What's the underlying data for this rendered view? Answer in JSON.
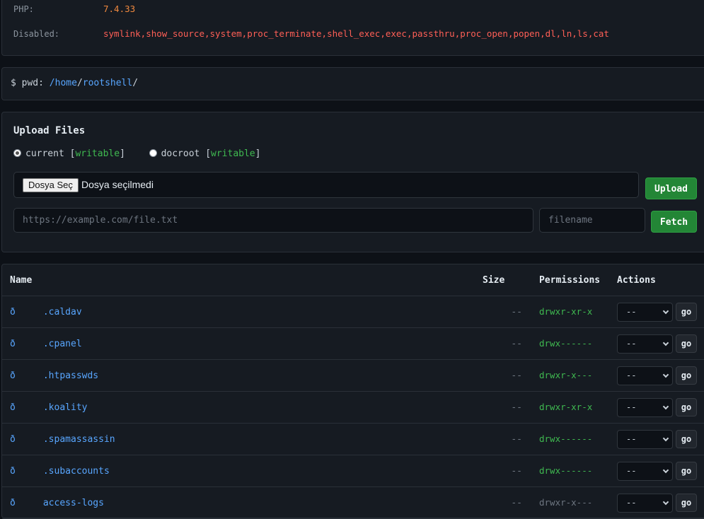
{
  "info": {
    "php_label": "PHP:",
    "php_value": "7.4.33",
    "disabled_label": "Disabled:",
    "disabled_value": "symlink,show_source,system,proc_terminate,shell_exec,exec,passthru,proc_open,popen,dl,ln,ls,cat"
  },
  "pwd": {
    "prefix": "$ pwd: ",
    "sep1": "/",
    "seg1": "home",
    "sep2": "/",
    "seg2": "rootshell",
    "sep3": "/"
  },
  "upload": {
    "title": "Upload Files",
    "radio_current": "current",
    "radio_docroot": "docroot",
    "bracket_open": "[",
    "bracket_close": "]",
    "writable": "writable",
    "choose_file": "Dosya Seç",
    "no_file": "Dosya seçilmedi",
    "upload_button": "Upload",
    "url_placeholder": "https://example.com/file.txt",
    "filename_placeholder": "filename",
    "fetch_button": "Fetch"
  },
  "table": {
    "headers": {
      "name": "Name",
      "size": "Size",
      "permissions": "Permissions",
      "actions": "Actions"
    },
    "rows": [
      {
        "icon": "ð",
        "name": ".caldav",
        "size": "--",
        "perm": "drwxr-xr-x",
        "perm_color": "#3fb950",
        "action": "--",
        "go": "go"
      },
      {
        "icon": "ð",
        "name": ".cpanel",
        "size": "--",
        "perm": "drwx------",
        "perm_color": "#3fb950",
        "action": "--",
        "go": "go"
      },
      {
        "icon": "ð",
        "name": ".htpasswds",
        "size": "--",
        "perm": "drwxr-x---",
        "perm_color": "#3fb950",
        "action": "--",
        "go": "go"
      },
      {
        "icon": "ð",
        "name": ".koality",
        "size": "--",
        "perm": "drwxr-xr-x",
        "perm_color": "#3fb950",
        "action": "--",
        "go": "go"
      },
      {
        "icon": "ð",
        "name": ".spamassassin",
        "size": "--",
        "perm": "drwx------",
        "perm_color": "#3fb950",
        "action": "--",
        "go": "go"
      },
      {
        "icon": "ð",
        "name": ".subaccounts",
        "size": "--",
        "perm": "drwx------",
        "perm_color": "#3fb950",
        "action": "--",
        "go": "go"
      },
      {
        "icon": "ð",
        "name": "access-logs",
        "size": "--",
        "perm": "drwxr-x---",
        "perm_color": "#6e7681",
        "action": "--",
        "go": "go"
      }
    ]
  }
}
